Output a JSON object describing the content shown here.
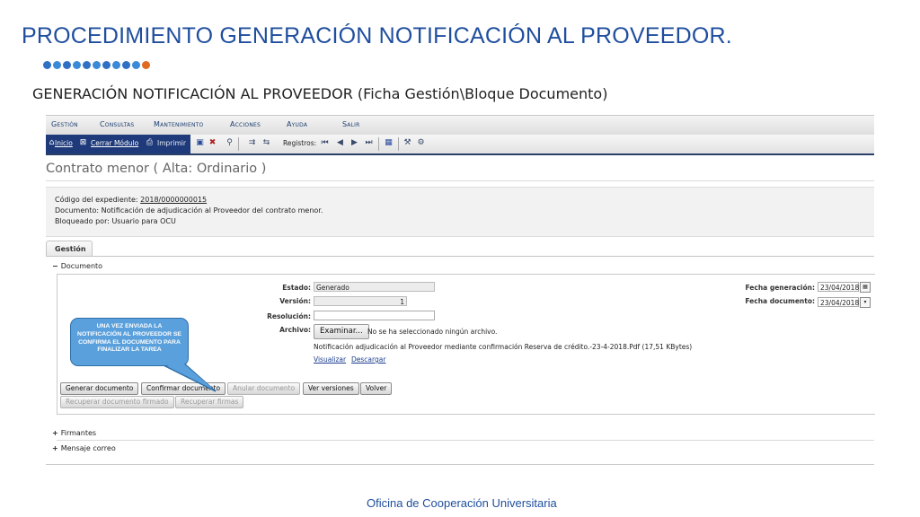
{
  "slide": {
    "title": "PROCEDIMIENTO GENERACIÓN NOTIFICACIÓN AL PROVEEDOR.",
    "subtitle": "GENERACIÓN NOTIFICACIÓN AL PROVEEDOR (Ficha Gestión\\Bloque Documento)",
    "footer": "Oficina de Cooperación Universitaria",
    "dot_colors": [
      "#2f6fc4",
      "#3a8ad8",
      "#2f6fc4",
      "#3a8ad8",
      "#2f6fc4",
      "#3a8ad8",
      "#2f6fc4",
      "#3a8ad8",
      "#2f6fc4",
      "#3a8ad8",
      "#e06a1f"
    ]
  },
  "menu": [
    "Gestión",
    "Consultas",
    "Mantenimiento",
    "Acciones",
    "Ayuda",
    "Salir"
  ],
  "toolbar": {
    "inicio": "Inicio",
    "cerrar": "Cerrar Módulo",
    "imprimir": "Imprimir",
    "registros": "Registros:"
  },
  "page": {
    "title": "Contrato menor ( Alta: Ordinario )",
    "info": {
      "codigo_label": "Código del expediente: ",
      "codigo_value": "2018/0000000015",
      "documento": "Documento: Notificación de adjudicación al Proveedor del contrato menor.",
      "bloqueado": "Bloqueado por: Usuario para OCU"
    },
    "tab": "Gestión"
  },
  "documento": {
    "section": "Documento",
    "estado_label": "Estado:",
    "estado_value": "Generado",
    "version_label": "Versión:",
    "version_value": "1",
    "resolucion_label": "Resolución:",
    "resolucion_value": "",
    "archivo_label": "Archivo:",
    "browse_label": "Examinar...",
    "no_file": "No se ha seleccionado ningún archivo.",
    "file_name": "Notificación adjudicación al Proveedor mediante confirmación Reserva de crédito.-23-4-2018.Pdf (17,51 KBytes)",
    "visualizar": "Visualizar",
    "descargar": "Descargar",
    "fecha_gen_label": "Fecha generación:",
    "fecha_gen_value": "23/04/2018",
    "fecha_doc_label": "Fecha documento:",
    "fecha_doc_value": "23/04/2018",
    "buttons": {
      "generar": "Generar documento",
      "confirmar": "Confirmar documento",
      "anular": "Anular documento",
      "ver_versiones": "Ver versiones",
      "volver": "Volver",
      "recuperar_firmado": "Recuperar documento firmado",
      "recuperar_firmas": "Recuperar firmas"
    }
  },
  "sections": {
    "firmantes": "Firmantes",
    "mensaje": "Mensaje correo"
  },
  "callout": "UNA VEZ ENVIADA LA NOTIFICACIÓN AL PROVEEDOR SE CONFIRMA EL DOCUMENTO PARA FINALIZAR LA TAREA"
}
